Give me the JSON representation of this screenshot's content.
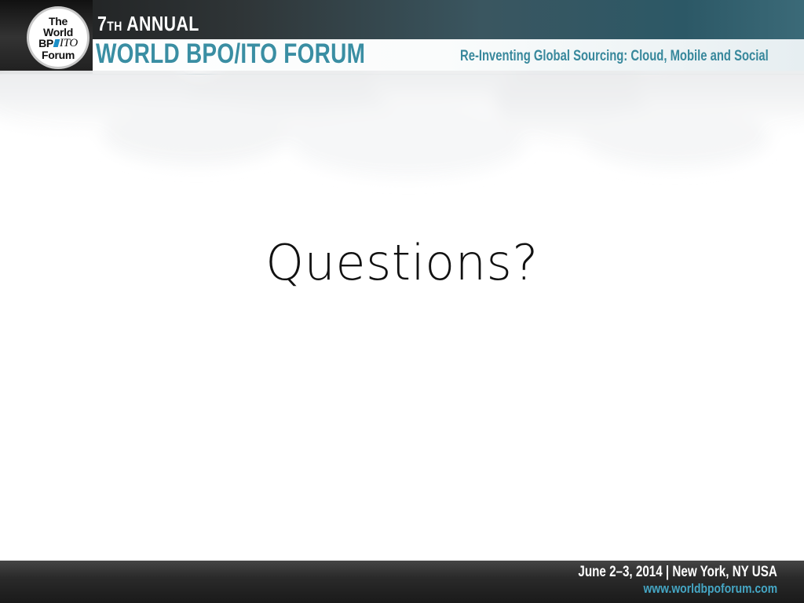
{
  "header": {
    "logo": {
      "line1": "The",
      "line2": "World",
      "line3_bp": "BP",
      "line3_ito": "ITO",
      "line4": "Forum"
    },
    "annual_number": "7",
    "annual_suffix": "TH",
    "annual_word": "ANNUAL",
    "forum_title": "WORLD BPO/ITO FORUM",
    "tagline": "Re-Inventing Global Sourcing: Cloud, Mobile and Social"
  },
  "body": {
    "title": "Questions?"
  },
  "footer": {
    "date_location": "June 2–3, 2014 | New York, NY USA",
    "url": "www.worldbpoforum.com"
  },
  "colors": {
    "accent_teal": "#3a8ea3",
    "footer_link": "#45a6c4",
    "header_dark": "#2f3537"
  }
}
